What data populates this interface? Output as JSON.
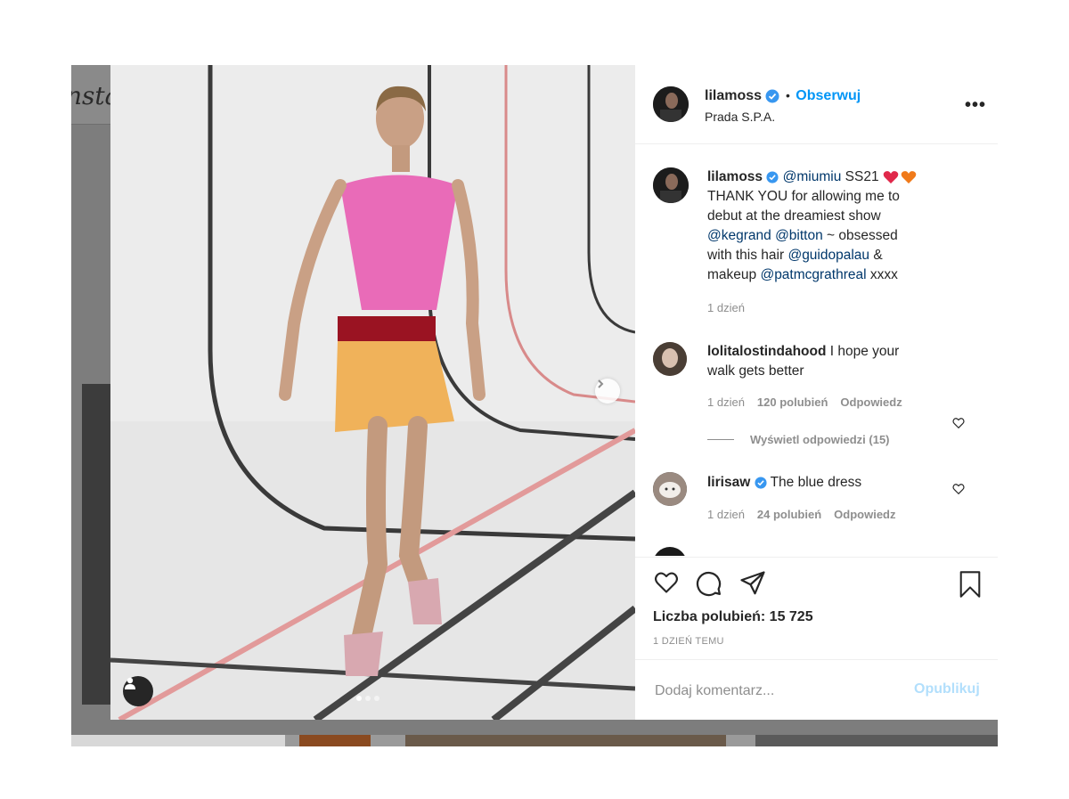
{
  "backdrop": {
    "logo_fragment": "nsta"
  },
  "post": {
    "username": "lilamoss",
    "follow_label": "Obserwuj",
    "separator": "•",
    "location": "Prada S.P.A.",
    "more": "•••"
  },
  "caption": {
    "username": "lilamoss",
    "mention1": "@miumiu",
    "text1": " SS21 ",
    "text2": "THANK YOU for allowing me to debut at the dreamiest show ",
    "mention2": "@kegrand",
    "mention3": "@bitton",
    "text3": " ~ obsessed with this hair ",
    "mention4": "@guidopalau",
    "text4": " & makeup ",
    "mention5": "@patmcgrathreal",
    "text5": " xxxx",
    "age": "1 dzień"
  },
  "comments": [
    {
      "username": "lolitalostindahood",
      "text": " I hope your walk gets better",
      "age": "1 dzień",
      "likes": "120 polubień",
      "reply": "Odpowiedz"
    },
    {
      "username": "lirisaw",
      "text": " The blue dress",
      "age": "1 dzień",
      "likes": "24 polubień",
      "reply": "Odpowiedz"
    }
  ],
  "view_replies": "Wyświetl odpowiedzi (15)",
  "likes_line": "Liczba polubień: 15 725",
  "posted": "1 DZIEŃ TEMU",
  "comment_input": {
    "placeholder": "Dodaj komentarz...",
    "value": ""
  },
  "publish_label": "Opublikuj",
  "carousel": {
    "count": 3,
    "active": 1
  },
  "icons": [
    "heart-icon",
    "comment-icon",
    "share-icon",
    "bookmark-icon",
    "verified-badge-icon",
    "chevron-right-icon",
    "user-tag-icon",
    "red-heart-emoji",
    "orange-heart-emoji"
  ],
  "colors": {
    "link": "#00376b",
    "follow": "#0095f6",
    "publish_disabled": "#b2dffc",
    "muted": "#8e8e8e"
  }
}
